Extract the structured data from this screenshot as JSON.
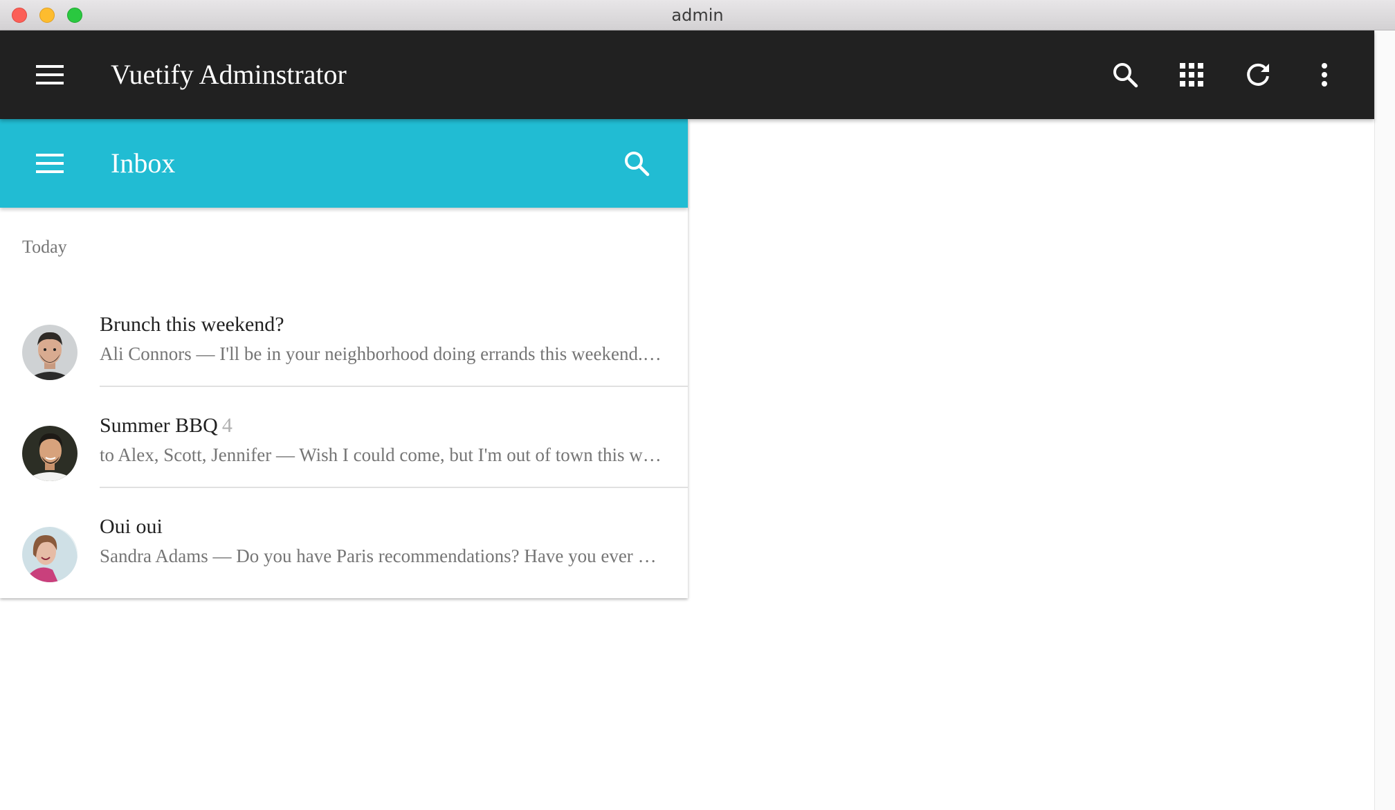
{
  "window": {
    "title": "admin"
  },
  "app_toolbar": {
    "title": "Vuetify Adminstrator",
    "icons": [
      "menu-icon",
      "search-icon",
      "apps-icon",
      "refresh-icon",
      "more-vert-icon"
    ]
  },
  "inbox": {
    "title": "Inbox",
    "accent_color": "#21bcd3",
    "subheader": "Today",
    "messages": [
      {
        "title": "Brunch this weekend?",
        "count": "",
        "sender": "Ali Connors",
        "preview": "I'll be in your neighborhood doing errands this weekend. Do you want to hang out?"
      },
      {
        "title": "Summer BBQ",
        "count": "4",
        "sender": "to Alex, Scott, Jennifer",
        "preview": "Wish I could come, but I'm out of town this weekend."
      },
      {
        "title": "Oui oui",
        "count": "",
        "sender": "Sandra Adams",
        "preview": "Do you have Paris recommendations? Have you ever been?"
      }
    ]
  },
  "colors": {
    "app_bar": "#212121",
    "inbox_bar": "#21bcd3"
  }
}
